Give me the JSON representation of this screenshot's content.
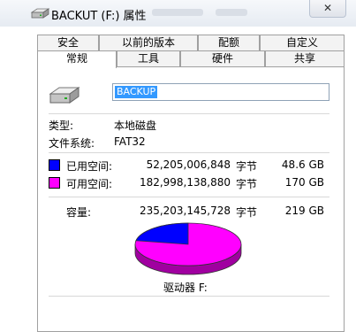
{
  "window": {
    "title": "BACKUT (F:) 属性",
    "close_glyph": "✕"
  },
  "tabs_row1": [
    "安全",
    "以前的版本",
    "配额",
    "自定义"
  ],
  "tabs_row2": [
    "常规",
    "工具",
    "硬件",
    "共享"
  ],
  "active_tab": "常规",
  "general": {
    "volume_name": "BACKUP",
    "type_label": "类型:",
    "type_value": "本地磁盘",
    "fs_label": "文件系统:",
    "fs_value": "FAT32",
    "used": {
      "label": "已用空间:",
      "bytes": "52,205,006,848",
      "unit": "字节",
      "size": "48.6 GB",
      "color": "#0000ff"
    },
    "free": {
      "label": "可用空间:",
      "bytes": "182,998,138,880",
      "unit": "字节",
      "size": "170 GB",
      "color": "#ff00ff"
    },
    "capacity": {
      "label": "容量:",
      "bytes": "235,203,145,728",
      "unit": "字节",
      "size": "219 GB"
    },
    "drive_label": "驱动器 F:"
  },
  "pie": {
    "used_fraction": 0.222,
    "used_color": "#0000ff",
    "free_color": "#ff00ff"
  },
  "icons": {
    "title": "drive-icon",
    "drive": "drive-icon"
  }
}
